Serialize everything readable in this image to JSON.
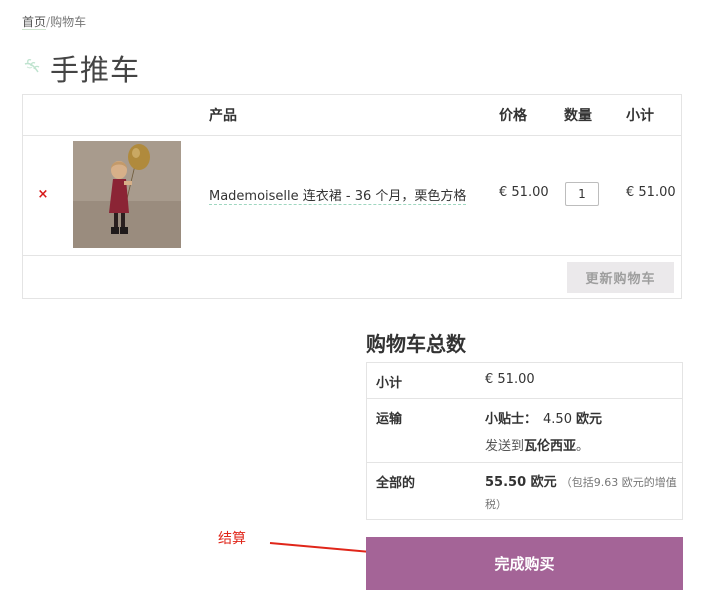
{
  "breadcrumb": {
    "home": "首页",
    "separator": "/",
    "current": "购物车"
  },
  "page": {
    "title": "手推车"
  },
  "cart_table": {
    "headers": {
      "product": "产品",
      "price": "价格",
      "quantity": "数量",
      "subtotal": "小计"
    },
    "items": [
      {
        "remove_symbol": "×",
        "name": "Mademoiselle 连衣裙 - 36 个月，栗色方格",
        "price": "€ 51.00",
        "quantity": "1",
        "subtotal": "€ 51.00"
      }
    ],
    "update_button": "更新购物车"
  },
  "totals": {
    "title": "购物车总数",
    "subtotal_label": "小计",
    "subtotal_value": "€ 51.00",
    "shipping_label": "运输",
    "shipping_method": "小贴士：",
    "shipping_amount": "4.50",
    "shipping_currency": "欧元",
    "ship_to_prefix": "发送到",
    "ship_to_place": "瓦伦西亚",
    "ship_to_suffix": "。",
    "total_label": "全部的",
    "total_value": "55.50 欧元",
    "tax_note": "（包括9.63 欧元的增值税）"
  },
  "annotation": {
    "text": "结算"
  },
  "checkout_button": "完成购买",
  "colors": {
    "accent": "#a46497",
    "remove": "#d71a1a",
    "annotation": "#e0261a",
    "update_bg": "#ebe9eb"
  }
}
